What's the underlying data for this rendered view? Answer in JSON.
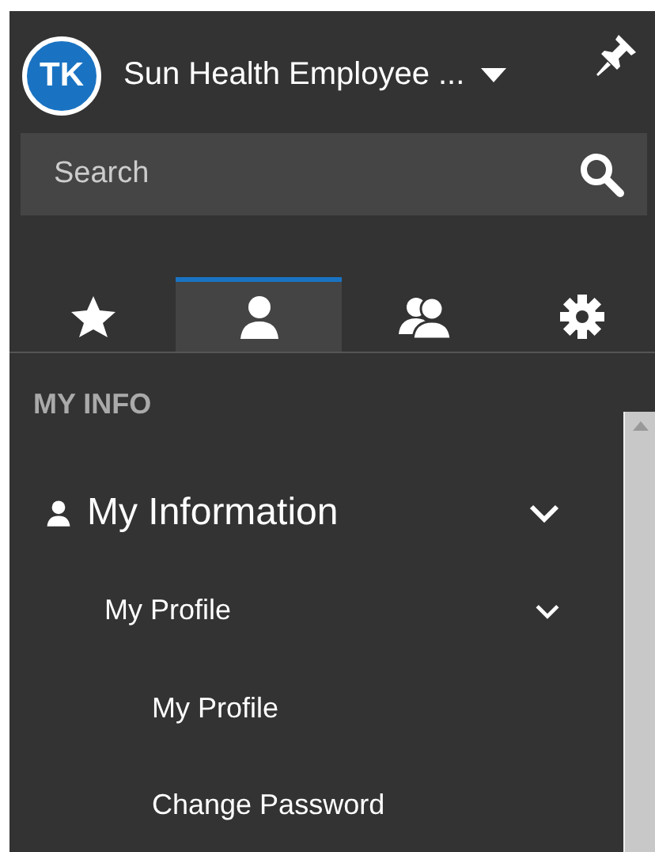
{
  "header": {
    "avatar_initials": "TK",
    "workspace": "Sun Health Employee ..."
  },
  "search": {
    "placeholder": "Search"
  },
  "tabs": [
    {
      "kind": "star",
      "selected": false
    },
    {
      "kind": "person",
      "selected": true
    },
    {
      "kind": "people",
      "selected": false
    },
    {
      "kind": "gear",
      "selected": false
    }
  ],
  "section_title": "MY INFO",
  "menu": [
    {
      "label": "My Information",
      "kind": "person",
      "expanded": true,
      "children": [
        {
          "label": "My Profile",
          "expanded": true,
          "children": [
            {
              "label": "My Profile"
            },
            {
              "label": "Change Password"
            }
          ]
        }
      ]
    }
  ]
}
